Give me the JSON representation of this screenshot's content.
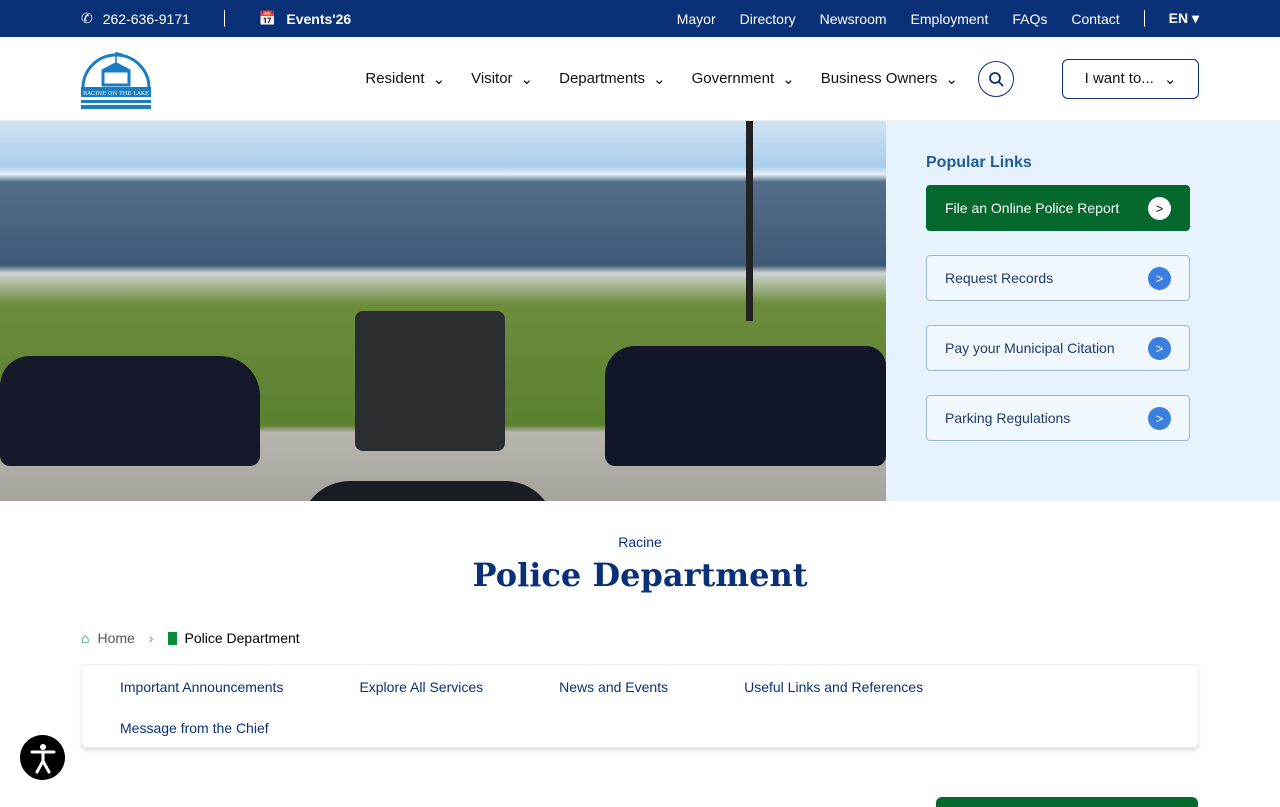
{
  "topbar": {
    "phone": "262-636-9171",
    "events": "Events'26",
    "links": [
      "Mayor",
      "Directory",
      "Newsroom",
      "Employment",
      "FAQs",
      "Contact"
    ],
    "language": "EN"
  },
  "header": {
    "logo_text": "RACINE ON THE LAKE",
    "nav": [
      "Resident",
      "Visitor",
      "Departments",
      "Government",
      "Business Owners"
    ],
    "i_want": "I want to..."
  },
  "popular": {
    "title": "Popular Links",
    "links": [
      "File an Online Police Report",
      "Request Records",
      "Pay your Municipal Citation",
      "Parking Regulations"
    ]
  },
  "page": {
    "subtitle": "Racine",
    "title": "Police Department"
  },
  "breadcrumb": {
    "home": "Home",
    "current": "Police Department"
  },
  "tabs": [
    "Important Announcements",
    "Explore All Services",
    "News and Events",
    "Useful Links and References",
    "Message from the Chief"
  ],
  "colors": {
    "navy": "#0a3178",
    "green": "#05682c",
    "light": "#e6f3fc"
  }
}
